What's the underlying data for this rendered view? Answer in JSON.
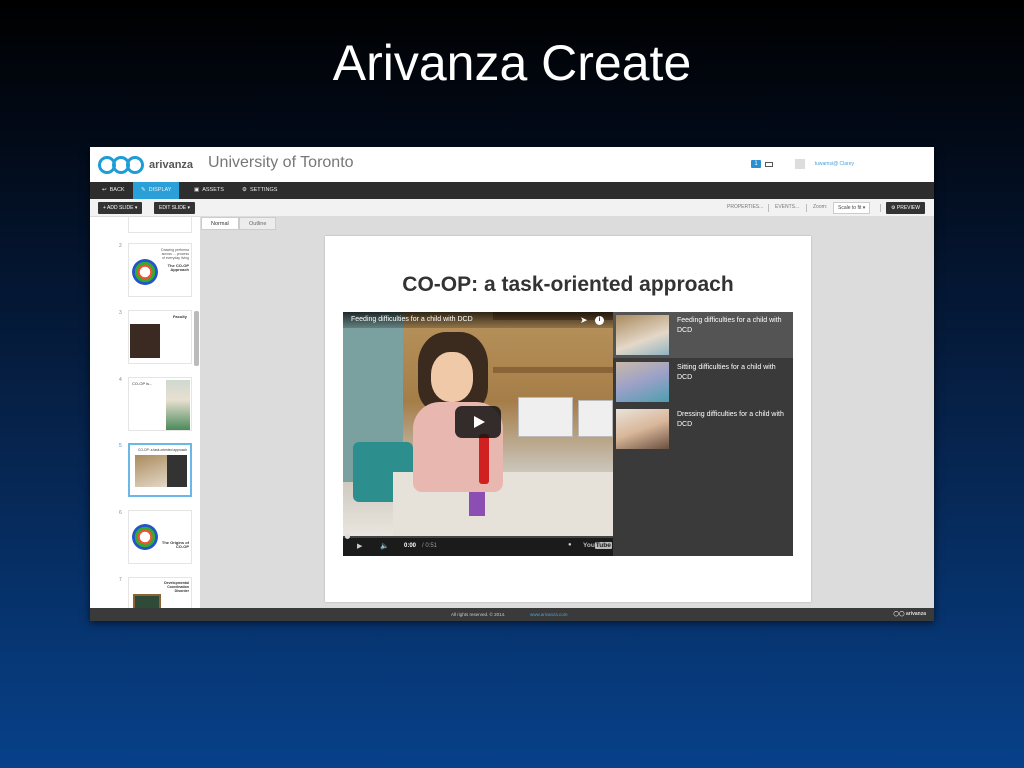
{
  "slide": {
    "title": "Arivanza Create"
  },
  "header": {
    "logo_text": "arivanza",
    "org_name": "University of Toronto",
    "notification_count": "1",
    "user_name": "tuwamsi@ Clarey"
  },
  "nav": {
    "items": [
      {
        "label": "BACK",
        "icon": "back-arrow-icon"
      },
      {
        "label": "DISPLAY",
        "icon": "pencil-icon",
        "active": true
      },
      {
        "label": "ASSETS",
        "icon": "assets-icon"
      },
      {
        "label": "SETTINGS",
        "icon": "gear-icon"
      }
    ]
  },
  "toolbar": {
    "add_slide": "ADD SLIDE",
    "edit_slide": "EDIT SLIDE",
    "properties": "PROPERTIES...",
    "events": "EVENTS...",
    "zoom_label": "Zoom:",
    "zoom_value": "Scale to fit",
    "preview": "PREVIEW"
  },
  "editor": {
    "tabs": [
      "Normal",
      "Outline"
    ]
  },
  "thumbnails": [
    {
      "num": "2",
      "lines": "Drawing performa\nacross ... process\nof everyday living",
      "title": "The CO-OP\nApproach"
    },
    {
      "num": "3",
      "title": "Faculty"
    },
    {
      "num": "4",
      "title": "CO-OP is..."
    },
    {
      "num": "5",
      "title": "CO-OP: a task-oriented approach",
      "selected": true
    },
    {
      "num": "6",
      "title": "The Origins of\nCO-OP"
    },
    {
      "num": "7",
      "title": "Developmental\nCoordination\nDisorder"
    }
  ],
  "canvas": {
    "title": "CO-OP: a task-oriented approach",
    "video": {
      "title": "Feeding difficulties for a child with DCD",
      "time_current": "0:00",
      "time_duration": "/ 0:51",
      "brand": "YouTube",
      "progress": 0.0
    },
    "playlist": [
      {
        "label": "Feeding difficulties for a child with DCD",
        "active": true
      },
      {
        "label": "Sitting difficulties for a child with DCD",
        "active": false
      },
      {
        "label": "Dressing difficulties for a child with DCD",
        "active": false
      }
    ]
  },
  "footer": {
    "copyright": "All rights reserved. © 2014.",
    "link": "www.arivanza.com",
    "logo": "arivanza"
  },
  "colors": {
    "accent": "#2b9fd8",
    "nav_bg": "#2d2d2d",
    "background_top": "#000000",
    "background_bottom": "#07418a"
  }
}
